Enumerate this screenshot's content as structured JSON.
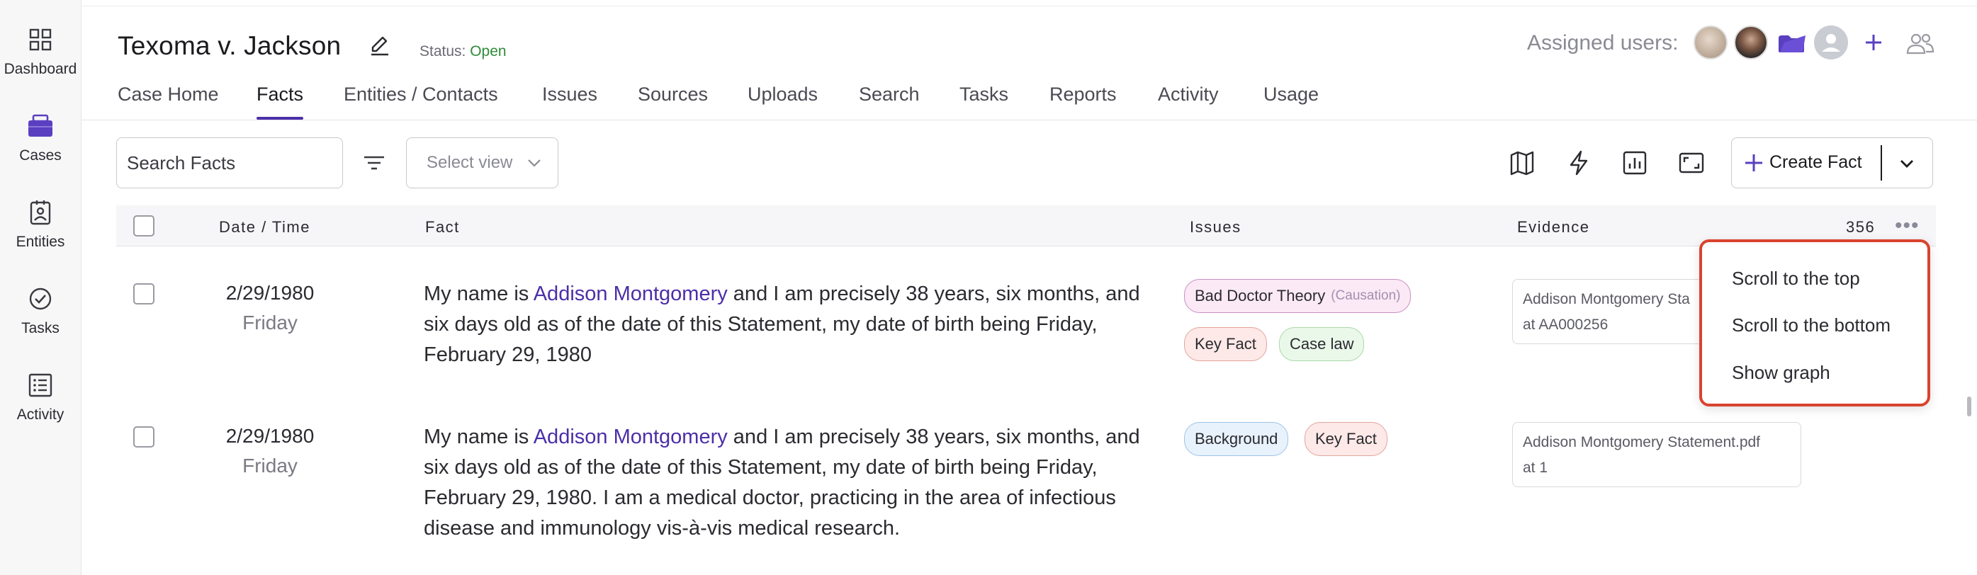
{
  "sidebar": {
    "items": [
      {
        "label": "Dashboard",
        "icon": "grid-icon"
      },
      {
        "label": "Cases",
        "icon": "briefcase-icon"
      },
      {
        "label": "Entities",
        "icon": "contact-card-icon"
      },
      {
        "label": "Tasks",
        "icon": "check-circle-icon"
      },
      {
        "label": "Activity",
        "icon": "list-icon"
      }
    ]
  },
  "header": {
    "title": "Texoma v. Jackson",
    "status_label": "Status:",
    "status_value": "Open",
    "assigned_label": "Assigned users:"
  },
  "tabs": [
    {
      "label": "Case Home"
    },
    {
      "label": "Facts"
    },
    {
      "label": "Entities / Contacts"
    },
    {
      "label": "Issues"
    },
    {
      "label": "Sources"
    },
    {
      "label": "Uploads"
    },
    {
      "label": "Search"
    },
    {
      "label": "Tasks"
    },
    {
      "label": "Reports"
    },
    {
      "label": "Activity"
    },
    {
      "label": "Usage"
    }
  ],
  "active_tab": "Facts",
  "toolbar": {
    "search_placeholder": "Search Facts",
    "select_view_placeholder": "Select view",
    "create_label": "Create Fact"
  },
  "table": {
    "headers": {
      "date": "Date / Time",
      "fact": "Fact",
      "issues": "Issues",
      "evidence": "Evidence"
    },
    "count": "356",
    "rows": [
      {
        "date": "2/29/1980",
        "day": "Friday",
        "fact_prefix": "My name is ",
        "fact_link": "Addison Montgomery",
        "fact_rest": " and I am precisely 38 years, six months, and six days old as of the date of this Statement, my date of birth being Friday, February 29, 1980",
        "tags": [
          {
            "label": "Bad Doctor Theory",
            "sub": "(Causation)",
            "color": "purple"
          },
          {
            "label": "Key Fact",
            "color": "red"
          },
          {
            "label": "Case law",
            "color": "green"
          }
        ],
        "evidence_line1": "Addison Montgomery Sta",
        "evidence_line2": "at AA000256"
      },
      {
        "date": "2/29/1980",
        "day": "Friday",
        "fact_prefix": "My name is ",
        "fact_link": "Addison Montgomery",
        "fact_rest": " and I am precisely 38 years, six months, and six days old as of the date of this Statement, my date of birth being Friday, February 29, 1980. I am a medical doctor, practicing in the area of infectious disease and immunology vis-à-vis medical research.",
        "tags": [
          {
            "label": "Background",
            "color": "blue"
          },
          {
            "label": "Key Fact",
            "color": "red"
          }
        ],
        "evidence_line1": "Addison Montgomery Statement.pdf",
        "evidence_line2": "at 1"
      }
    ]
  },
  "popup_menu": {
    "items": [
      {
        "label": "Scroll to the top"
      },
      {
        "label": "Scroll to the bottom"
      },
      {
        "label": "Show graph"
      }
    ],
    "highlight_color": "#d9432e"
  },
  "colors": {
    "accent": "#4b2fa8",
    "status_open": "#2e8b3a"
  }
}
